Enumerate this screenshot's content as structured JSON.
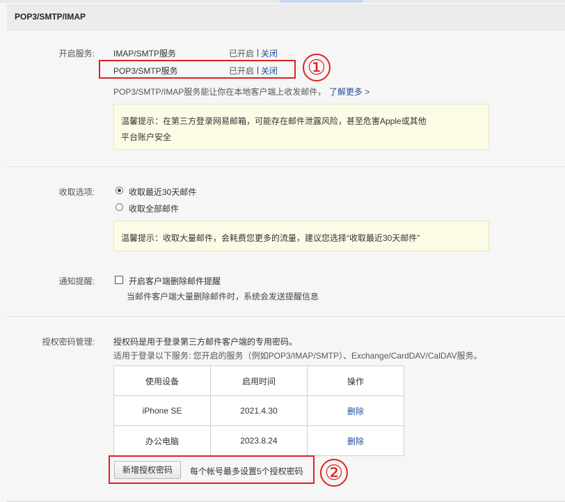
{
  "header": {
    "title": "POP3/SMTP/IMAP"
  },
  "service": {
    "label": "开启服务:",
    "items": [
      {
        "name": "IMAP/SMTP服务",
        "status": "已开启",
        "separator": "|",
        "action": "关闭"
      },
      {
        "name": "POP3/SMTP服务",
        "status": "已开启",
        "separator": "|",
        "action": "关闭"
      }
    ],
    "desc": "POP3/SMTP/IMAP服务能让你在本地客户端上收发邮件，",
    "learn_more": "了解更多 >",
    "tip_line1": "温馨提示：在第三方登录网易邮箱，可能存在邮件泄露风险，甚至危害Apple或其他",
    "tip_line2": "平台账户安全"
  },
  "receive": {
    "label": "收取选项:",
    "options": [
      {
        "label": "收取最近30天邮件",
        "checked": true
      },
      {
        "label": "收取全部邮件",
        "checked": false
      }
    ],
    "tip": "温馨提示：收取大量邮件，会耗费您更多的流量，建议您选择“收取最近30天邮件”"
  },
  "notify": {
    "label": "通知提醒:",
    "checkbox_label": "开启客户端删除邮件提醒",
    "desc": "当邮件客户端大量删除邮件时，系统会发送提醒信息"
  },
  "auth": {
    "label": "授权密码管理:",
    "desc1": "授权码是用于登录第三方邮件客户端的专用密码。",
    "desc2": "适用于登录以下服务: 您开启的服务（例如POP3/IMAP/SMTP）、Exchange/CardDAV/CalDAV服务。",
    "columns": [
      "使用设备",
      "启用时间",
      "操作"
    ],
    "rows": [
      {
        "device": "iPhone SE",
        "date": "2021.4.30",
        "action": "删除"
      },
      {
        "device": "办公电脑",
        "date": "2023.8.24",
        "action": "删除"
      }
    ],
    "add_button": "新增授权密码",
    "limit_note": "每个帐号最多设置5个授权密码"
  },
  "annotations": [
    "①",
    "②"
  ],
  "colors": {
    "accent_link": "#1f4d9b",
    "annotation_red": "#e02020",
    "tip_bg": "#fbfbe6"
  }
}
